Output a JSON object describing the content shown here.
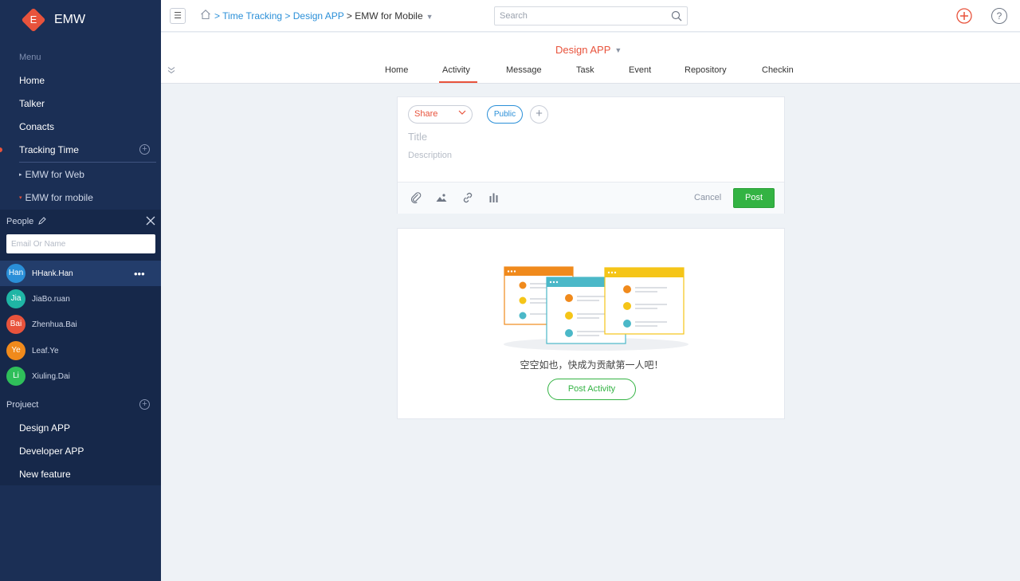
{
  "brand": {
    "logo_letter": "E",
    "name": "EMW"
  },
  "sidebar": {
    "menu_label": "Menu",
    "items": [
      {
        "label": "Home"
      },
      {
        "label": "Talker"
      },
      {
        "label": "Conacts"
      },
      {
        "label": "Tracking Time",
        "active": true
      }
    ],
    "sub_items": [
      {
        "label": "EMW for Web",
        "marker": "▸"
      },
      {
        "label": "EMW for mobile",
        "marker": "▾"
      }
    ]
  },
  "people": {
    "title": "People",
    "search_placeholder": "Email Or Name",
    "list": [
      {
        "initials": "Han",
        "name": "HHank.Han",
        "color": "#2a8fd8",
        "active": true
      },
      {
        "initials": "Jia",
        "name": "JiaBo.ruan",
        "color": "#1fb5a5"
      },
      {
        "initials": "Bai",
        "name": "Zhenhua.Bai",
        "color": "#e8533c"
      },
      {
        "initials": "Ye",
        "name": "Leaf.Ye",
        "color": "#f08a1c"
      },
      {
        "initials": "Li",
        "name": "Xiuling.Dai",
        "color": "#2fbf5a"
      }
    ],
    "more": "•••"
  },
  "projects": {
    "title": "Projuect",
    "items": [
      {
        "label": "Design APP"
      },
      {
        "label": "Developer APP"
      },
      {
        "label": "New feature"
      }
    ]
  },
  "topbar": {
    "breadcrumb": [
      ">",
      "Time Tracking",
      ">",
      "Design APP",
      ">",
      "EMW for Mobile"
    ],
    "search_placeholder": "Search",
    "help": "?"
  },
  "subheader": {
    "project": "Design APP",
    "tabs": [
      "Home",
      "Activity",
      "Message",
      "Task",
      "Event",
      "Repository",
      "Checkin"
    ],
    "active_tab": "Activity"
  },
  "composer": {
    "share_label": "Share",
    "public_label": "Public",
    "title_placeholder": "Title",
    "description_placeholder": "Description",
    "cancel_label": "Cancel",
    "post_label": "Post"
  },
  "empty_state": {
    "message": "空空如也，快成为贡献第一人吧！",
    "button_label": "Post Activity"
  },
  "colors": {
    "sidebar_bg": "#1b2f55",
    "accent": "#e8533c",
    "link": "#2a8fd8",
    "success": "#33b343"
  }
}
